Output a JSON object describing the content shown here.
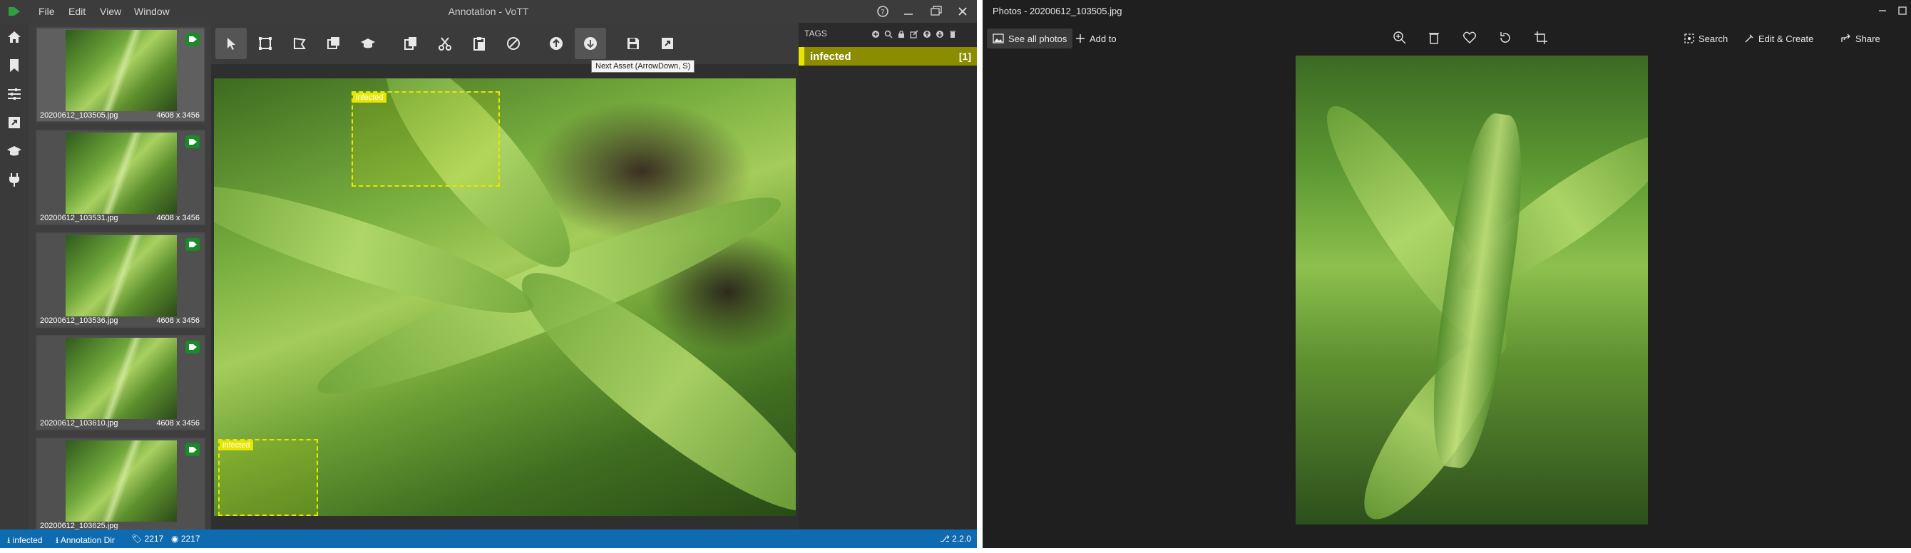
{
  "vott": {
    "menu": [
      "File",
      "Edit",
      "View",
      "Window"
    ],
    "window_title": "Annotation - VoTT",
    "toolbar_tooltip": "Next Asset (ArrowDown, S)",
    "assets": [
      {
        "filename": "20200612_103505.jpg",
        "dims": "4608 x 3456",
        "tagged": true,
        "active": true
      },
      {
        "filename": "20200612_103531.jpg",
        "dims": "4608 x 3456",
        "tagged": true,
        "active": false
      },
      {
        "filename": "20200612_103536.jpg",
        "dims": "4608 x 3456",
        "tagged": true,
        "active": false
      },
      {
        "filename": "20200612_103610.jpg",
        "dims": "4608 x 3456",
        "tagged": true,
        "active": false
      },
      {
        "filename": "20200612_103625.jpg",
        "dims": "",
        "tagged": true,
        "active": false
      }
    ],
    "regions": [
      {
        "label": "infected"
      },
      {
        "label": "infected"
      }
    ],
    "tags_panel": {
      "header": "TAGS",
      "tags": [
        {
          "name": "infected",
          "count": "[1]",
          "color": "#e6e600"
        }
      ]
    },
    "status": {
      "tag_name": "infected",
      "directory": "Annotation Dir",
      "tag_count": "2217",
      "visited_count": "2217",
      "version": "2.2.0"
    },
    "colors": {
      "status_bar": "#0e6bb0",
      "tag_yellow": "#e6e600",
      "badge_green": "#1a8a2a"
    }
  },
  "photos": {
    "title": "Photos - 20200612_103505.jpg",
    "see_all_label": "See all photos",
    "add_to_label": "Add to",
    "search_label": "Search",
    "edit_create_label": "Edit & Create",
    "share_label": "Share"
  }
}
